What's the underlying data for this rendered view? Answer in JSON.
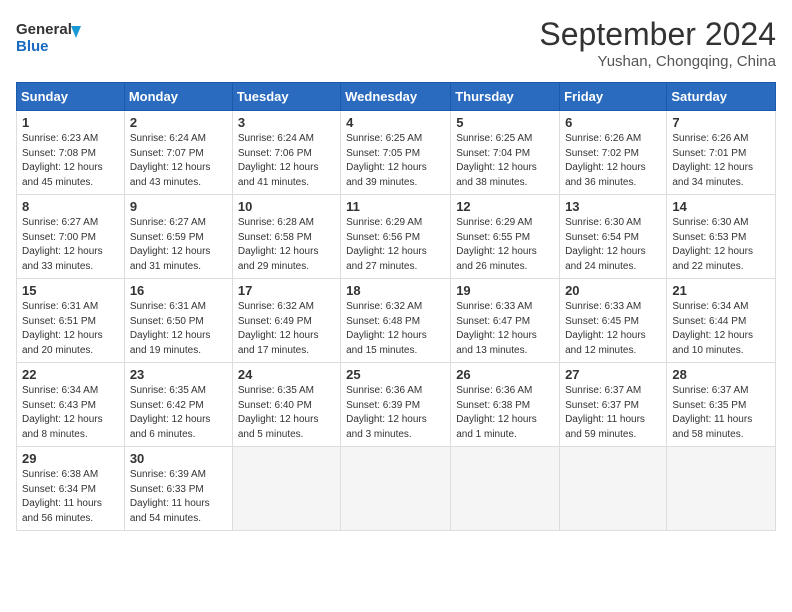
{
  "header": {
    "logo_line1": "General",
    "logo_line2": "Blue",
    "month_title": "September 2024",
    "location": "Yushan, Chongqing, China"
  },
  "weekdays": [
    "Sunday",
    "Monday",
    "Tuesday",
    "Wednesday",
    "Thursday",
    "Friday",
    "Saturday"
  ],
  "weeks": [
    [
      {
        "day": "1",
        "info": "Sunrise: 6:23 AM\nSunset: 7:08 PM\nDaylight: 12 hours\nand 45 minutes."
      },
      {
        "day": "2",
        "info": "Sunrise: 6:24 AM\nSunset: 7:07 PM\nDaylight: 12 hours\nand 43 minutes."
      },
      {
        "day": "3",
        "info": "Sunrise: 6:24 AM\nSunset: 7:06 PM\nDaylight: 12 hours\nand 41 minutes."
      },
      {
        "day": "4",
        "info": "Sunrise: 6:25 AM\nSunset: 7:05 PM\nDaylight: 12 hours\nand 39 minutes."
      },
      {
        "day": "5",
        "info": "Sunrise: 6:25 AM\nSunset: 7:04 PM\nDaylight: 12 hours\nand 38 minutes."
      },
      {
        "day": "6",
        "info": "Sunrise: 6:26 AM\nSunset: 7:02 PM\nDaylight: 12 hours\nand 36 minutes."
      },
      {
        "day": "7",
        "info": "Sunrise: 6:26 AM\nSunset: 7:01 PM\nDaylight: 12 hours\nand 34 minutes."
      }
    ],
    [
      {
        "day": "8",
        "info": "Sunrise: 6:27 AM\nSunset: 7:00 PM\nDaylight: 12 hours\nand 33 minutes."
      },
      {
        "day": "9",
        "info": "Sunrise: 6:27 AM\nSunset: 6:59 PM\nDaylight: 12 hours\nand 31 minutes."
      },
      {
        "day": "10",
        "info": "Sunrise: 6:28 AM\nSunset: 6:58 PM\nDaylight: 12 hours\nand 29 minutes."
      },
      {
        "day": "11",
        "info": "Sunrise: 6:29 AM\nSunset: 6:56 PM\nDaylight: 12 hours\nand 27 minutes."
      },
      {
        "day": "12",
        "info": "Sunrise: 6:29 AM\nSunset: 6:55 PM\nDaylight: 12 hours\nand 26 minutes."
      },
      {
        "day": "13",
        "info": "Sunrise: 6:30 AM\nSunset: 6:54 PM\nDaylight: 12 hours\nand 24 minutes."
      },
      {
        "day": "14",
        "info": "Sunrise: 6:30 AM\nSunset: 6:53 PM\nDaylight: 12 hours\nand 22 minutes."
      }
    ],
    [
      {
        "day": "15",
        "info": "Sunrise: 6:31 AM\nSunset: 6:51 PM\nDaylight: 12 hours\nand 20 minutes."
      },
      {
        "day": "16",
        "info": "Sunrise: 6:31 AM\nSunset: 6:50 PM\nDaylight: 12 hours\nand 19 minutes."
      },
      {
        "day": "17",
        "info": "Sunrise: 6:32 AM\nSunset: 6:49 PM\nDaylight: 12 hours\nand 17 minutes."
      },
      {
        "day": "18",
        "info": "Sunrise: 6:32 AM\nSunset: 6:48 PM\nDaylight: 12 hours\nand 15 minutes."
      },
      {
        "day": "19",
        "info": "Sunrise: 6:33 AM\nSunset: 6:47 PM\nDaylight: 12 hours\nand 13 minutes."
      },
      {
        "day": "20",
        "info": "Sunrise: 6:33 AM\nSunset: 6:45 PM\nDaylight: 12 hours\nand 12 minutes."
      },
      {
        "day": "21",
        "info": "Sunrise: 6:34 AM\nSunset: 6:44 PM\nDaylight: 12 hours\nand 10 minutes."
      }
    ],
    [
      {
        "day": "22",
        "info": "Sunrise: 6:34 AM\nSunset: 6:43 PM\nDaylight: 12 hours\nand 8 minutes."
      },
      {
        "day": "23",
        "info": "Sunrise: 6:35 AM\nSunset: 6:42 PM\nDaylight: 12 hours\nand 6 minutes."
      },
      {
        "day": "24",
        "info": "Sunrise: 6:35 AM\nSunset: 6:40 PM\nDaylight: 12 hours\nand 5 minutes."
      },
      {
        "day": "25",
        "info": "Sunrise: 6:36 AM\nSunset: 6:39 PM\nDaylight: 12 hours\nand 3 minutes."
      },
      {
        "day": "26",
        "info": "Sunrise: 6:36 AM\nSunset: 6:38 PM\nDaylight: 12 hours\nand 1 minute."
      },
      {
        "day": "27",
        "info": "Sunrise: 6:37 AM\nSunset: 6:37 PM\nDaylight: 11 hours\nand 59 minutes."
      },
      {
        "day": "28",
        "info": "Sunrise: 6:37 AM\nSunset: 6:35 PM\nDaylight: 11 hours\nand 58 minutes."
      }
    ],
    [
      {
        "day": "29",
        "info": "Sunrise: 6:38 AM\nSunset: 6:34 PM\nDaylight: 11 hours\nand 56 minutes."
      },
      {
        "day": "30",
        "info": "Sunrise: 6:39 AM\nSunset: 6:33 PM\nDaylight: 11 hours\nand 54 minutes."
      },
      {
        "day": "",
        "info": ""
      },
      {
        "day": "",
        "info": ""
      },
      {
        "day": "",
        "info": ""
      },
      {
        "day": "",
        "info": ""
      },
      {
        "day": "",
        "info": ""
      }
    ]
  ]
}
